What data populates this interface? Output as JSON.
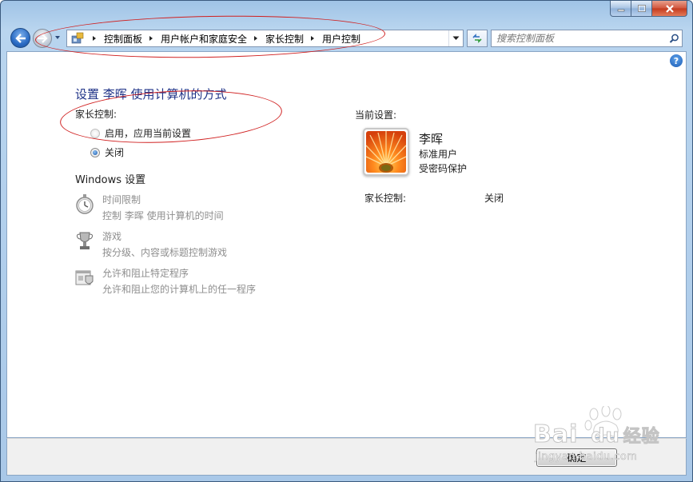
{
  "nav": {
    "breadcrumbs": [
      "控制面板",
      "用户帐户和家庭安全",
      "家长控制",
      "用户控制"
    ],
    "search_placeholder": "搜索控制面板"
  },
  "main": {
    "title": "设置 李晖 使用计算机的方式",
    "parental_controls_label": "家长控制:",
    "option_on": "启用，应用当前设置",
    "option_off": "关闭",
    "selected_option": "关闭",
    "windows_settings_heading": "Windows 设置",
    "settings": [
      {
        "title": "时间限制",
        "desc": "控制 李晖 使用计算机的时间",
        "icon": "stopwatch-icon"
      },
      {
        "title": "游戏",
        "desc": "按分级、内容或标题控制游戏",
        "icon": "trophy-icon"
      },
      {
        "title": "允许和阻止特定程序",
        "desc": "允许和阻止您的计算机上的任一程序",
        "icon": "program-shield-icon"
      }
    ]
  },
  "current": {
    "heading": "当前设置:",
    "user_name": "李晖",
    "user_type": "标准用户",
    "password_status": "受密码保护",
    "parental_label": "家长控制:",
    "parental_value": "关闭"
  },
  "footer": {
    "ok_label": "确定"
  },
  "watermark": {
    "brand": "Bai",
    "brand2": "du",
    "brand_cn": "经验",
    "url": "jingyan.baidu.com"
  },
  "colors": {
    "title_blue": "#1e3287",
    "annotation_red": "#d02020",
    "disabled_gray": "#8e8e8e"
  }
}
